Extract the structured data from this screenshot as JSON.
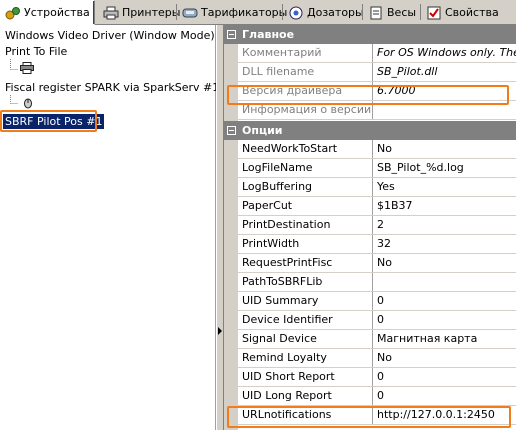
{
  "tabs": [
    {
      "label": "Устройства",
      "icon": "devices-icon",
      "active": true
    },
    {
      "label": "Принтеры",
      "icon": "printer-icon",
      "active": false
    },
    {
      "label": "Тарификаторы",
      "icon": "tariff-icon",
      "active": false
    },
    {
      "label": "Дозаторы",
      "icon": "dispenser-icon",
      "active": false
    },
    {
      "label": "Весы",
      "icon": "scales-icon",
      "active": false
    },
    {
      "label": "Свойства",
      "icon": "properties-icon",
      "active": false
    }
  ],
  "tree": {
    "items": [
      {
        "label": "Windows Video Driver (Window Mode)"
      },
      {
        "label": "Print To File"
      },
      {
        "label": "Fiscal register SPARK via SparkServ #1"
      },
      {
        "label": "SBRF Pilot Pos #1"
      }
    ]
  },
  "grid": {
    "main_category": "Главное",
    "main_rows": [
      {
        "key": "Комментарий",
        "value": "For OS Windows only. The D"
      },
      {
        "key": "DLL filename",
        "value": "SB_Pilot.dll"
      },
      {
        "key": "Версия драйвера",
        "value": "6.7000"
      },
      {
        "key": "Информация о версии",
        "value": ""
      }
    ],
    "options_category": "Опции",
    "option_rows": [
      {
        "key": "NeedWorkToStart",
        "value": "No"
      },
      {
        "key": "LogFileName",
        "value": "SB_Pilot_%d.log"
      },
      {
        "key": "LogBuffering",
        "value": "Yes"
      },
      {
        "key": "PaperCut",
        "value": "$1B37"
      },
      {
        "key": "PrintDestination",
        "value": "2"
      },
      {
        "key": "PrintWidth",
        "value": "32"
      },
      {
        "key": "RequestPrintFisc",
        "value": "No"
      },
      {
        "key": "PathToSBRFLib",
        "value": ""
      },
      {
        "key": "UID Summary",
        "value": "0"
      },
      {
        "key": "Device Identifier",
        "value": "0"
      },
      {
        "key": "Signal Device",
        "value": "Магнитная карта"
      },
      {
        "key": "Remind Loyalty",
        "value": "No"
      },
      {
        "key": "UID Short Report",
        "value": "0"
      },
      {
        "key": "UID Long Report",
        "value": "0"
      },
      {
        "key": "URLnotifications",
        "value": "http://127.0.0.1:2450"
      }
    ]
  },
  "colors": {
    "highlight": "#f07d1a",
    "selection": "#0a246a",
    "category": "#808080"
  }
}
